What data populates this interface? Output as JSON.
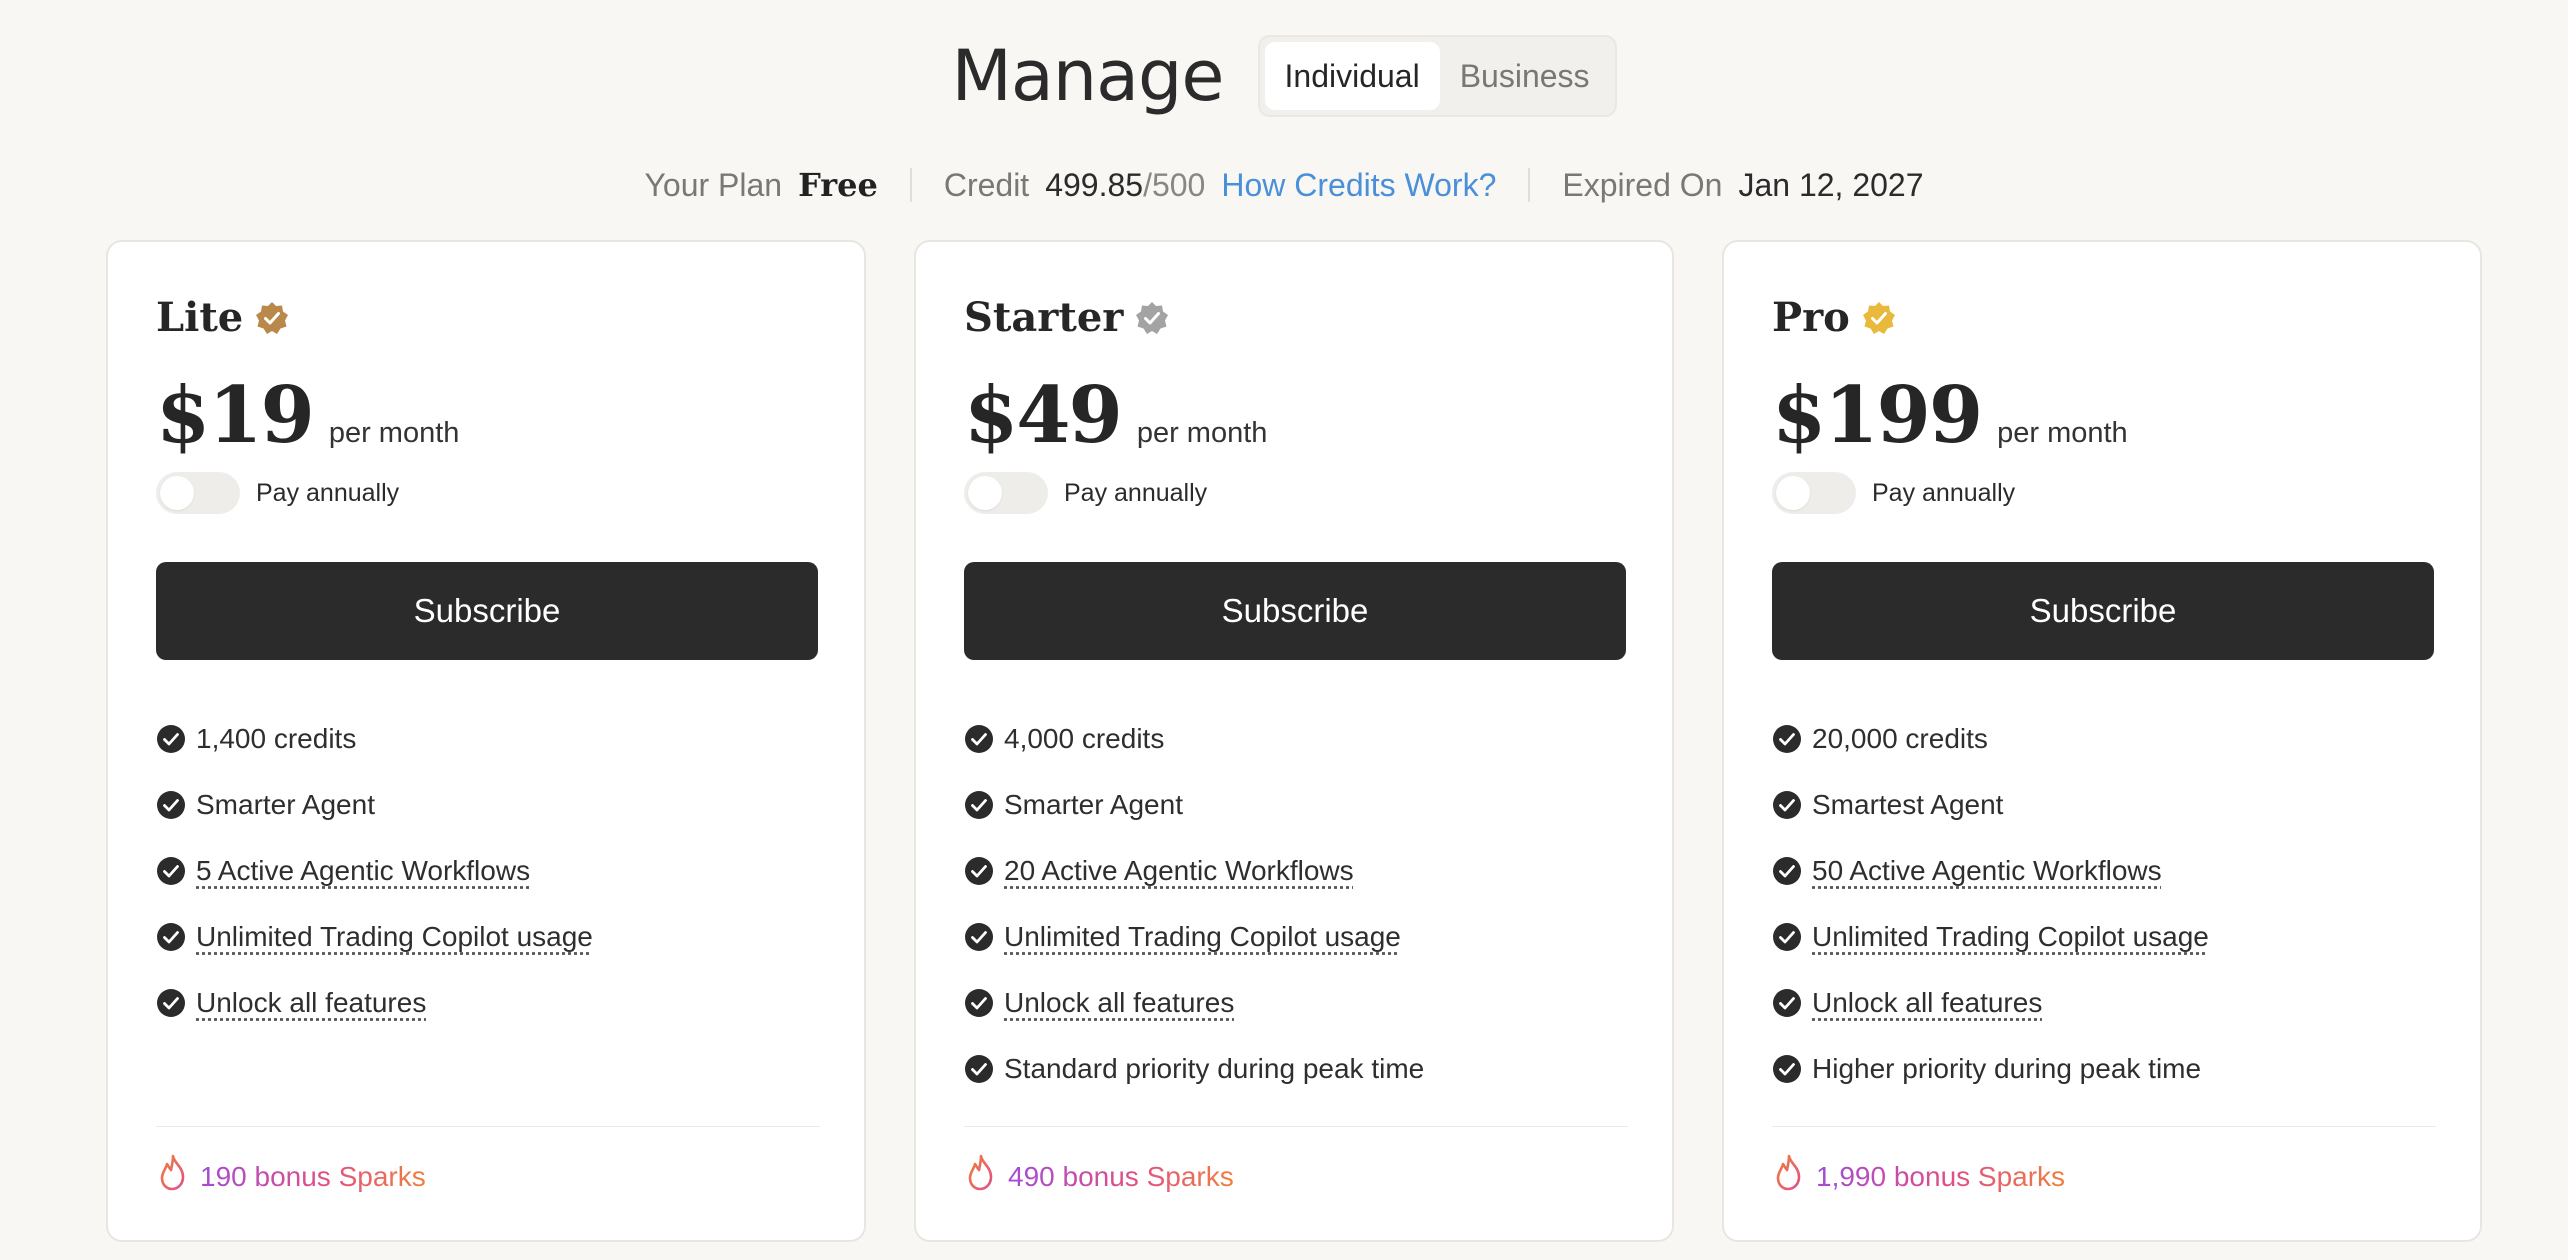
{
  "header": {
    "title": "Manage",
    "tabs": [
      {
        "label": "Individual",
        "active": true
      },
      {
        "label": "Business",
        "active": false
      }
    ]
  },
  "status": {
    "plan_label": "Your Plan",
    "plan_value": "Free",
    "credit_label": "Credit",
    "credit_used": "499.85",
    "credit_total": "/500",
    "credit_link": "How Credits Work?",
    "expiry_label": "Expired On",
    "expiry_value": "Jan 12, 2027"
  },
  "colors": {
    "accent_link": "#4a90d9",
    "button_bg": "#2b2b2b",
    "badge_lite": "#b8894a",
    "badge_starter": "#a3a3a3",
    "badge_pro": "#e8b93a",
    "bonus_gradient": [
      "#a34bd8",
      "#e04f86",
      "#f07f3c"
    ]
  },
  "plans": [
    {
      "name": "Lite",
      "badge_icon": "verified-badge-bronze-icon",
      "price": "$19",
      "period": "per month",
      "annual_label": "Pay annually",
      "annual_on": false,
      "button": "Subscribe",
      "features": [
        {
          "text": "1,400 credits",
          "dotted": false
        },
        {
          "text": "Smarter Agent",
          "dotted": false
        },
        {
          "text": "5 Active Agentic Workflows",
          "dotted": true
        },
        {
          "text": "Unlimited Trading Copilot usage",
          "dotted": true
        },
        {
          "text": "Unlock all features",
          "dotted": true
        }
      ],
      "bonus": "190 bonus Sparks"
    },
    {
      "name": "Starter",
      "badge_icon": "verified-badge-silver-icon",
      "price": "$49",
      "period": "per month",
      "annual_label": "Pay annually",
      "annual_on": false,
      "button": "Subscribe",
      "features": [
        {
          "text": "4,000 credits",
          "dotted": false
        },
        {
          "text": "Smarter Agent",
          "dotted": false
        },
        {
          "text": "20 Active Agentic Workflows",
          "dotted": true
        },
        {
          "text": "Unlimited Trading Copilot usage",
          "dotted": true
        },
        {
          "text": "Unlock all features",
          "dotted": true
        },
        {
          "text": "Standard priority during peak time",
          "dotted": false
        }
      ],
      "bonus": "490 bonus Sparks"
    },
    {
      "name": "Pro",
      "badge_icon": "verified-badge-gold-icon",
      "price": "$199",
      "period": "per month",
      "annual_label": "Pay annually",
      "annual_on": false,
      "button": "Subscribe",
      "features": [
        {
          "text": "20,000 credits",
          "dotted": false
        },
        {
          "text": "Smartest Agent",
          "dotted": false
        },
        {
          "text": "50 Active Agentic Workflows",
          "dotted": true
        },
        {
          "text": "Unlimited Trading Copilot usage",
          "dotted": true
        },
        {
          "text": "Unlock all features",
          "dotted": true
        },
        {
          "text": "Higher priority during peak time",
          "dotted": false
        }
      ],
      "bonus": "1,990 bonus Sparks"
    }
  ]
}
